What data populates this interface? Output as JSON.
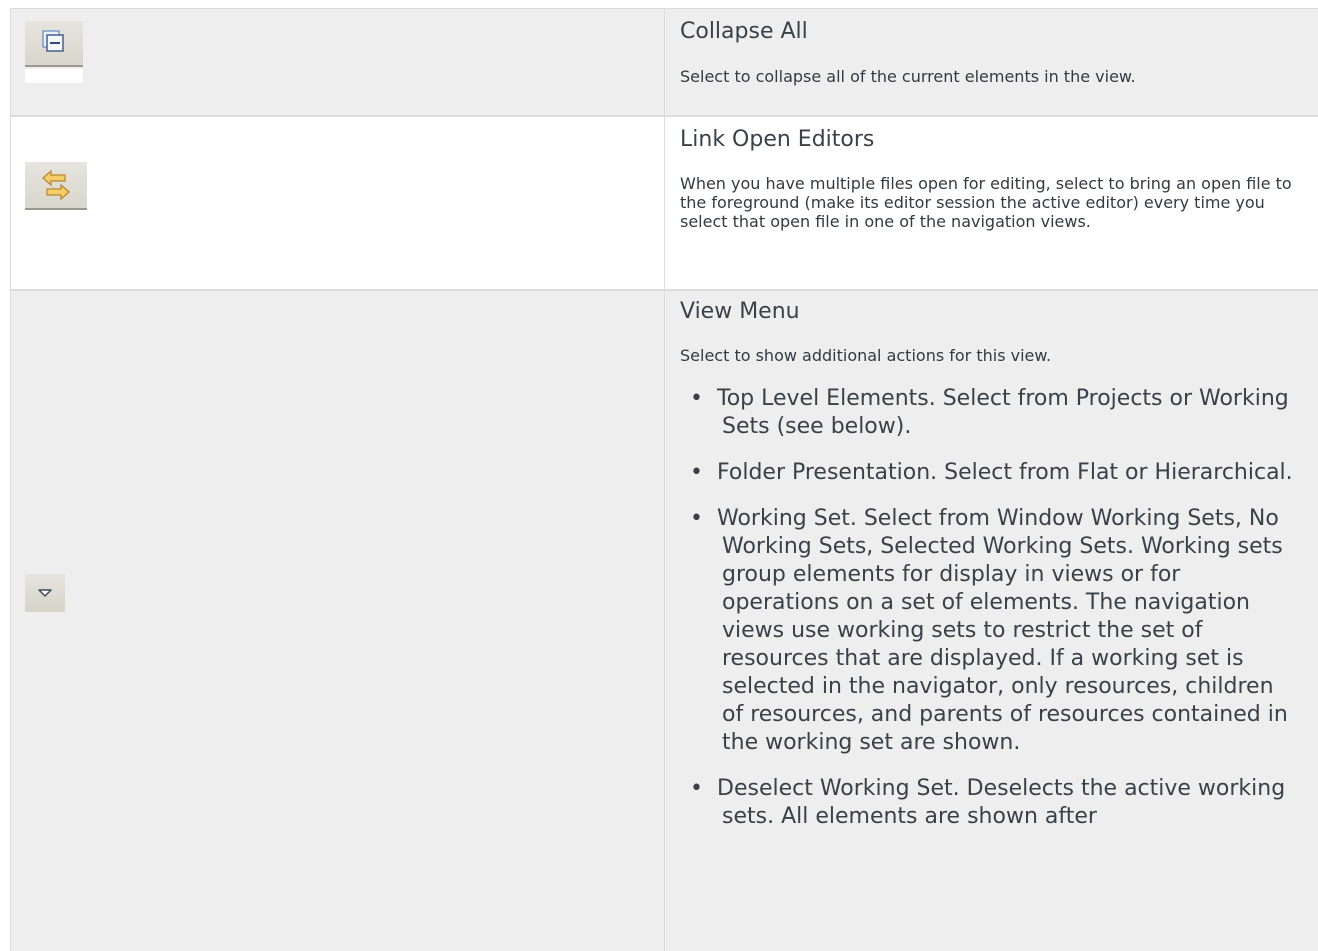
{
  "rows": [
    {
      "icon": "collapse-all-icon",
      "title": "Collapse All",
      "description": "Select to collapse all of the current elements in the view."
    },
    {
      "icon": "link-editors-icon",
      "title": "Link Open Editors",
      "description": "When you have multiple files open for editing, select to bring an open file to the foreground (make its editor session the active editor) every time you select that open file in one of the navigation views."
    },
    {
      "icon": "view-menu-icon",
      "title": "View Menu",
      "description": "Select to show additional actions for this view.",
      "items": [
        "Top Level Elements. Select from Projects or Working Sets (see below).",
        "Folder Presentation. Select from Flat or Hierarchical.",
        "Working Set. Select from Window Working Sets, No Working Sets, Selected Working Sets. Working sets group elements for display in views or for operations on a set of elements. The navigation views use working sets to restrict the set of resources that are displayed. If a working set is selected in the navigator, only resources, children of resources, and parents of resources contained in the working set are shown.",
        "Deselect Working Set. Deselects the active working sets. All elements are shown after"
      ]
    }
  ],
  "colors": {
    "row_shaded": "#eeeeee",
    "row_white": "#ffffff",
    "border": "#dcdcdc",
    "text": "#333a40"
  }
}
